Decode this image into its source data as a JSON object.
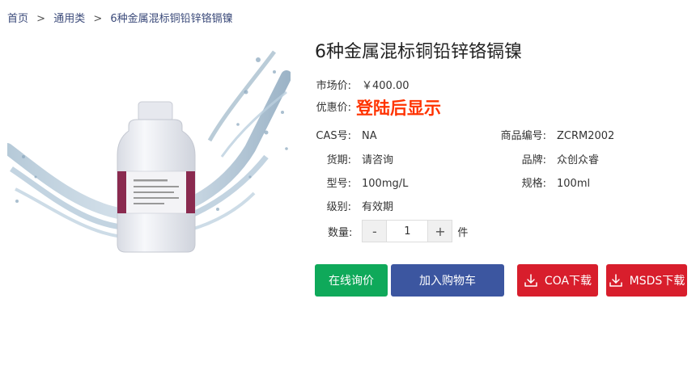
{
  "breadcrumb": {
    "home": "首页",
    "category": "通用类",
    "current": "6种金属混标铜铅锌铬镉镍",
    "separator": ">"
  },
  "product": {
    "title": "6种金属混标铜铅锌铬镉镍",
    "market_price_label": "市场价:",
    "market_price": "￥400.00",
    "promo_label": "优惠价:",
    "promo_value": "登陆后显示",
    "cas_label": "CAS号:",
    "cas_value": "NA",
    "code_label": "商品编号:",
    "code_value": "ZCRM2002",
    "delivery_label": "货期:",
    "delivery_value": "请咨询",
    "brand_label": "品牌:",
    "brand_value": "众创众睿",
    "model_label": "型号:",
    "model_value": "100mg/L",
    "spec_label": "规格:",
    "spec_value": "100ml",
    "grade_label": "级别:",
    "grade_value": "有效期"
  },
  "quantity": {
    "label": "数量:",
    "minus": "-",
    "value": "1",
    "plus": "+",
    "unit": "件"
  },
  "buttons": {
    "inquiry": "在线询价",
    "cart": "加入购物车",
    "coa": "COA下载",
    "msds": "MSDS下载"
  },
  "colors": {
    "promo": "#ff3300",
    "inquiry_button": "#0fa95a",
    "cart_button": "#3c56a0",
    "download_button": "#d81e2c",
    "breadcrumb_link": "#3b4a7a"
  },
  "icons": {
    "download": "download-icon",
    "product_image": "reagent-bottle-with-water-splash"
  }
}
